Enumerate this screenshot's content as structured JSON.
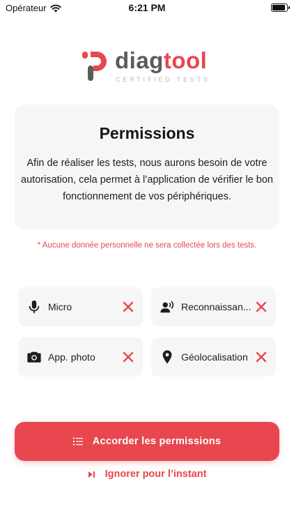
{
  "status_bar": {
    "carrier": "Opérateur",
    "time": "6:21 PM",
    "battery_level": 0.9
  },
  "logo": {
    "word_part1": "diag",
    "word_part2": "tool",
    "tagline": "CERTIFIED TESTS",
    "colors": {
      "brand": "#e8474f",
      "dark": "#5b5b5b"
    }
  },
  "card": {
    "title": "Permissions",
    "text": "Afin de réaliser les tests, nous aurons besoin de votre autorisation, cela permet à l’application de vérifier le bon fonctionnement de vos périphériques."
  },
  "notice": "* Aucune donnée personnelle ne sera collectée lors des tests.",
  "permissions": [
    {
      "label": "Micro",
      "icon": "microphone-icon",
      "status_icon": "close-icon",
      "granted": false
    },
    {
      "label": "Reconnaissan...",
      "icon": "voice-recognition-icon",
      "status_icon": "close-icon",
      "granted": false
    },
    {
      "label": "App. photo",
      "icon": "camera-icon",
      "status_icon": "close-icon",
      "granted": false
    },
    {
      "label": "Géolocalisation",
      "icon": "location-pin-icon",
      "status_icon": "close-icon",
      "granted": false
    }
  ],
  "actions": {
    "primary_label": "Accorder les permissions",
    "primary_icon": "checklist-icon",
    "secondary_label": "Ignorer pour l’instant",
    "secondary_icon": "skip-icon"
  },
  "colors": {
    "accent": "#e8474f",
    "tile_bg": "#f6f6f7"
  }
}
